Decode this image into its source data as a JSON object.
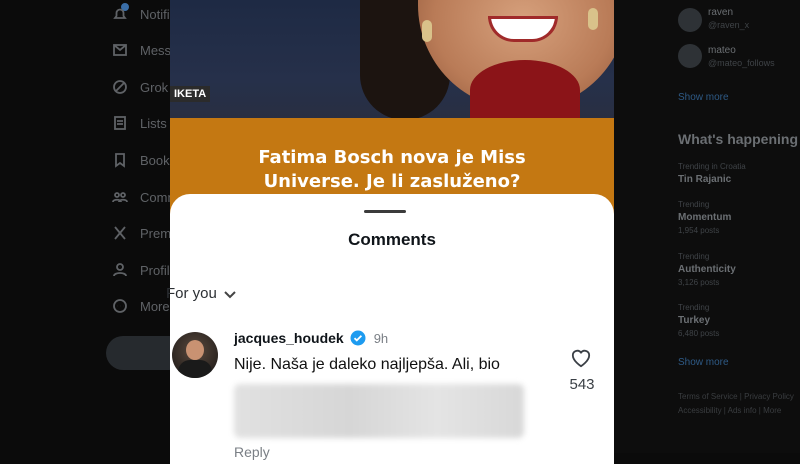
{
  "background": {
    "nav": [
      "Notifications",
      "Messages",
      "Grok",
      "Lists",
      "Bookmarks",
      "Communities",
      "Premium",
      "Profile",
      "More"
    ],
    "right": {
      "accounts": [
        {
          "name": "raven",
          "sub": "@raven_x"
        },
        {
          "name": "mateo",
          "sub": "@mateo_follows"
        }
      ],
      "show_more": "Show more",
      "whats_happening": "What's happening",
      "trends": [
        {
          "category": "Trending in Croatia",
          "name": "Tin Rajanic",
          "count": ""
        },
        {
          "category": "Trending",
          "name": "Momentum",
          "count": "1,954 posts"
        },
        {
          "category": "Trending",
          "name": "Authenticity",
          "count": "3,126 posts"
        },
        {
          "category": "Trending",
          "name": "Turkey",
          "count": "6,480 posts"
        }
      ],
      "show_more_2": "Show more",
      "footer": [
        "Terms of Service | Privacy Policy",
        "Accessibility | Ads info | More"
      ]
    }
  },
  "video": {
    "brand": "IKETA",
    "headline_line1": "Fatima Bosch nova je Miss",
    "headline_line2": "Universe. Je li zasluženo?"
  },
  "comments_sheet": {
    "title": "Comments",
    "filter_label": "For you",
    "comment": {
      "username": "jacques_houdek",
      "time": "9h",
      "text": "Nije. Naša je daleko najljepša. Ali, bio",
      "likes": "543",
      "reply_label": "Reply"
    }
  },
  "colors": {
    "verified": "#1d9bf0",
    "orange_band": "#c47812"
  }
}
